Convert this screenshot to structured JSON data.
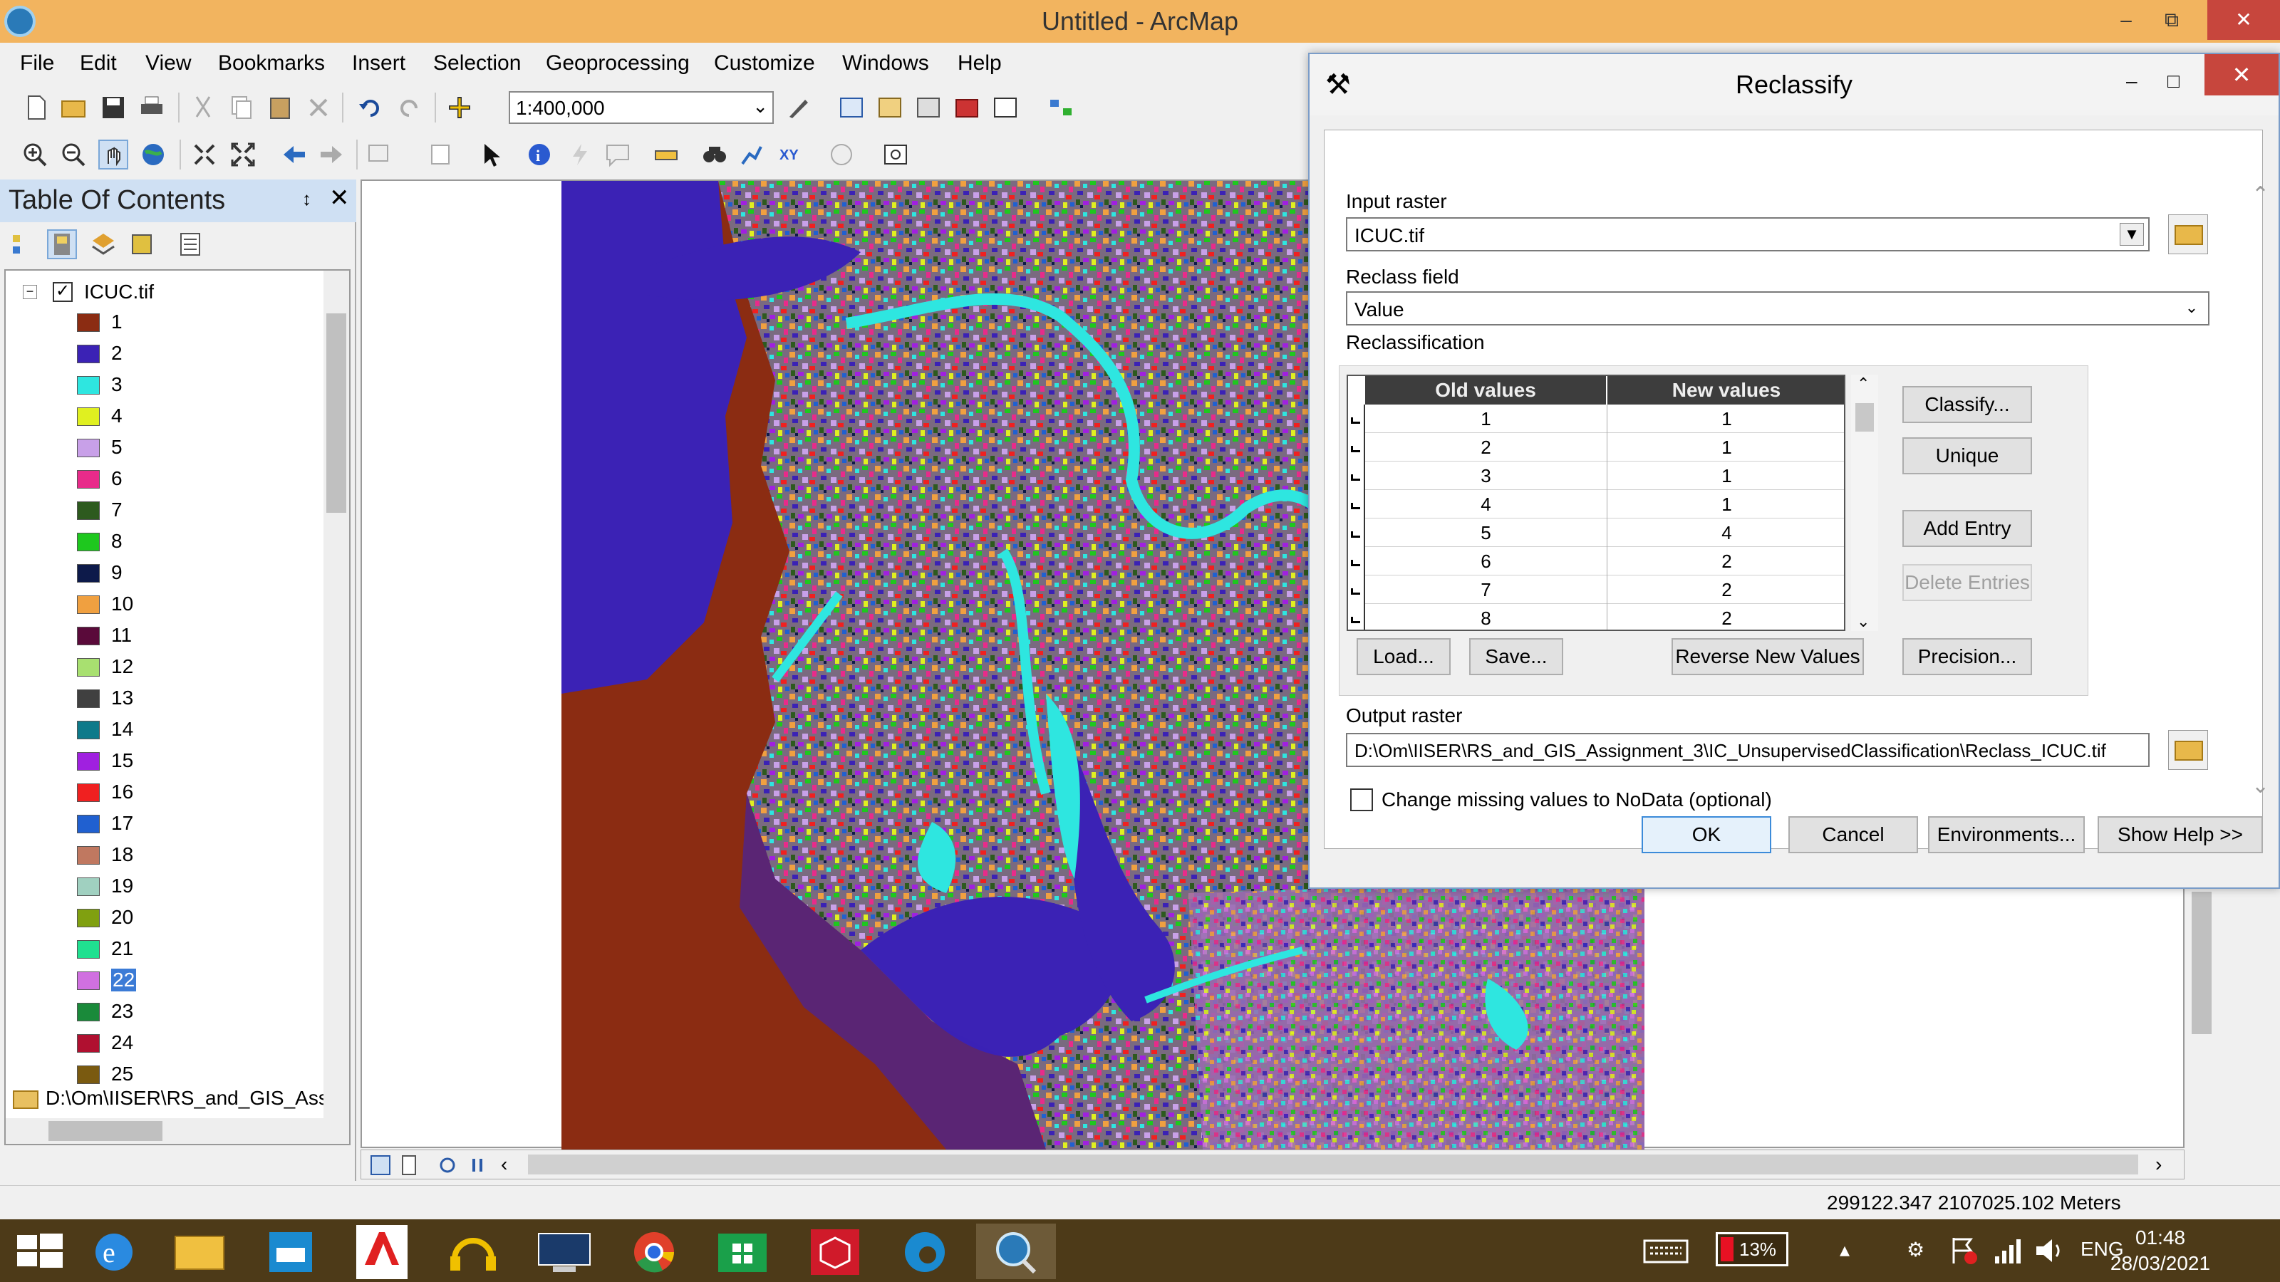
{
  "window": {
    "title": "Untitled - ArcMap",
    "minimize": "–",
    "restore": "⧉",
    "close": "✕"
  },
  "menu": [
    "File",
    "Edit",
    "View",
    "Bookmarks",
    "Insert",
    "Selection",
    "Geoprocessing",
    "Customize",
    "Windows",
    "Help"
  ],
  "toolbar": {
    "scale": "1:400,000"
  },
  "toc": {
    "title": "Table Of Contents",
    "pin": "↕",
    "close": "✕",
    "layer_name": "ICUC.tif",
    "legend": [
      {
        "label": "1",
        "color": "#8b2c12"
      },
      {
        "label": "2",
        "color": "#3b22b5"
      },
      {
        "label": "3",
        "color": "#2ee6e0"
      },
      {
        "label": "4",
        "color": "#e0f020"
      },
      {
        "label": "5",
        "color": "#c8a0e8"
      },
      {
        "label": "6",
        "color": "#e82b8a"
      },
      {
        "label": "7",
        "color": "#2d5a1e"
      },
      {
        "label": "8",
        "color": "#1ec81e"
      },
      {
        "label": "9",
        "color": "#0d1a4a"
      },
      {
        "label": "10",
        "color": "#f0a040"
      },
      {
        "label": "11",
        "color": "#5a0a3a"
      },
      {
        "label": "12",
        "color": "#a8e070"
      },
      {
        "label": "13",
        "color": "#404040"
      },
      {
        "label": "14",
        "color": "#0e7a8a"
      },
      {
        "label": "15",
        "color": "#a020e0"
      },
      {
        "label": "16",
        "color": "#f02020"
      },
      {
        "label": "17",
        "color": "#2060d0"
      },
      {
        "label": "18",
        "color": "#c07860"
      },
      {
        "label": "19",
        "color": "#a0d0c0"
      },
      {
        "label": "20",
        "color": "#80a010"
      },
      {
        "label": "21",
        "color": "#20e090"
      },
      {
        "label": "22",
        "color": "#d070e0"
      },
      {
        "label": "23",
        "color": "#1a8a3a"
      },
      {
        "label": "24",
        "color": "#b01030"
      },
      {
        "label": "25",
        "color": "#7a5a10"
      }
    ],
    "selected_label": "22",
    "folder_path": "D:\\Om\\IISER\\RS_and_GIS_Ass"
  },
  "status": {
    "coords": "299122.347  2107025.102 Meters"
  },
  "dialog": {
    "title": "Reclassify",
    "input_raster_label": "Input raster",
    "input_raster_value": "ICUC.tif",
    "reclass_field_label": "Reclass field",
    "reclass_field_value": "Value",
    "reclassification_label": "Reclassification",
    "columns": [
      "Old values",
      "New values"
    ],
    "rows": [
      {
        "old": "1",
        "new": "1"
      },
      {
        "old": "2",
        "new": "1"
      },
      {
        "old": "3",
        "new": "1"
      },
      {
        "old": "4",
        "new": "1"
      },
      {
        "old": "5",
        "new": "4"
      },
      {
        "old": "6",
        "new": "2"
      },
      {
        "old": "7",
        "new": "2"
      },
      {
        "old": "8",
        "new": "2"
      }
    ],
    "buttons": {
      "classify": "Classify...",
      "unique": "Unique",
      "add_entry": "Add Entry",
      "delete_entries": "Delete Entries",
      "load": "Load...",
      "save": "Save...",
      "reverse": "Reverse New Values",
      "precision": "Precision...",
      "ok": "OK",
      "cancel": "Cancel",
      "environments": "Environments...",
      "show_help": "Show Help >>"
    },
    "output_raster_label": "Output raster",
    "output_raster_value": "D:\\Om\\IISER\\RS_and_GIS_Assignment_3\\IC_UnsupervisedClassification\\Reclass_ICUC.tif",
    "nodata_label": "Change missing values to NoData (optional)"
  },
  "taskbar": {
    "battery": "13%",
    "language": "ENG",
    "time": "01:48",
    "date": "28/03/2021"
  }
}
